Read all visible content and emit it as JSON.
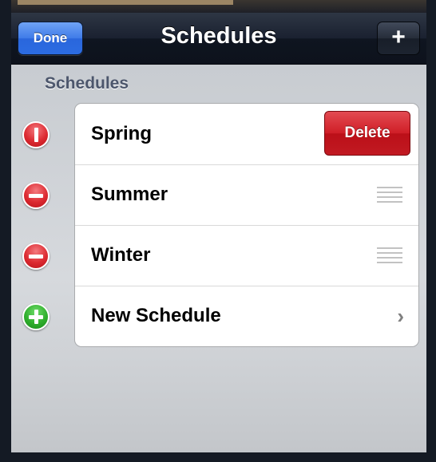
{
  "navbar": {
    "title": "Schedules",
    "done_label": "Done",
    "add_label": "+"
  },
  "section": {
    "header": "Schedules"
  },
  "rows": [
    {
      "label": "Spring",
      "control": "delete-confirm-active",
      "accessory": "delete-button"
    },
    {
      "label": "Summer",
      "control": "delete",
      "accessory": "reorder-grabber"
    },
    {
      "label": "Winter",
      "control": "delete",
      "accessory": "reorder-grabber"
    },
    {
      "label": "New Schedule",
      "control": "insert",
      "accessory": "chevron"
    }
  ],
  "delete_label": "Delete",
  "chevron_glyph": "›",
  "colors": {
    "done_button": "#3f7be8",
    "delete_button": "#cf1e27",
    "delete_control": "#dc2a31",
    "insert_control": "#2fae2c",
    "section_header": "#4c566c"
  },
  "icons": {
    "add": "plus-icon",
    "delete_control": "minus-circle-icon",
    "insert_control": "plus-circle-icon",
    "reorder": "reorder-grabber-icon",
    "disclosure": "chevron-right-icon"
  }
}
